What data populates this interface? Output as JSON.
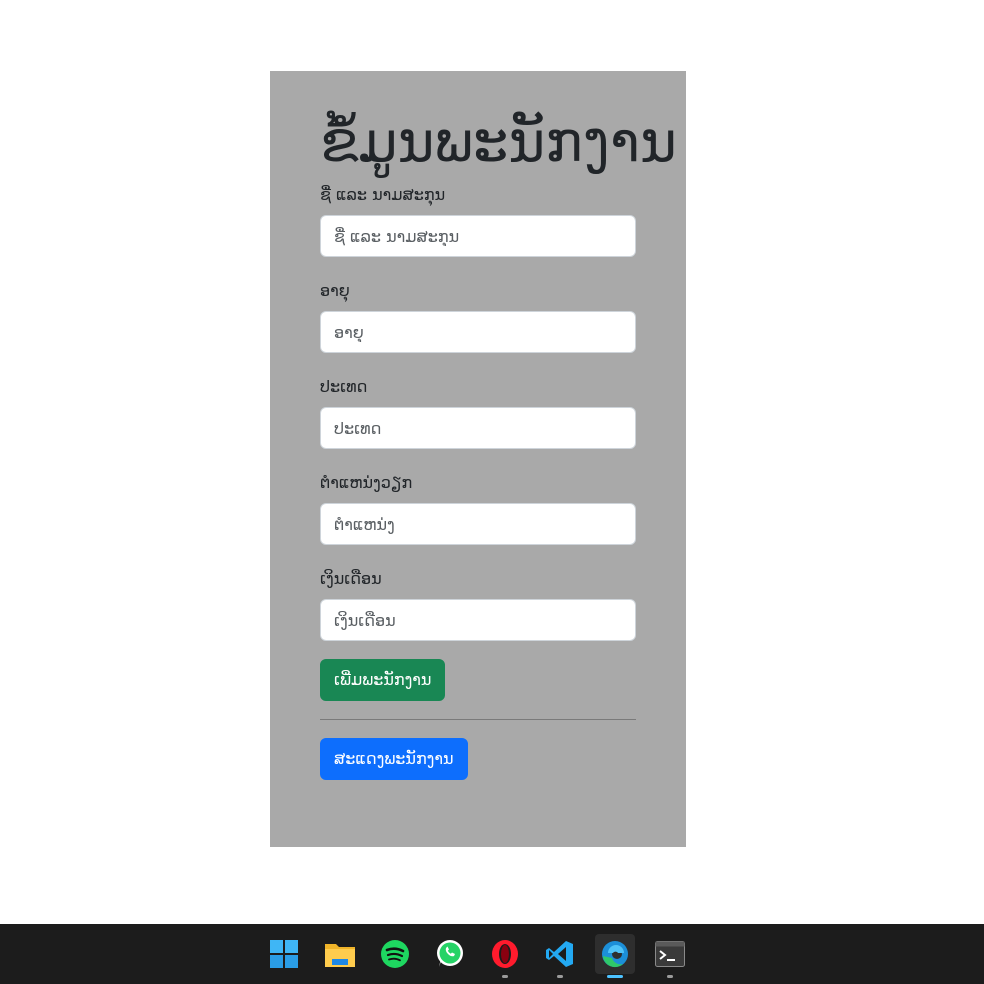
{
  "form": {
    "title": "ຂໍ້ມູນພະນັກງານ",
    "fields": [
      {
        "label": "ຊື່ ແລະ ນາມສະກຸນ",
        "placeholder": "ຊື່ ແລະ ນາມສະກຸນ",
        "value": ""
      },
      {
        "label": "ອາຍຸ",
        "placeholder": "ອາຍຸ",
        "value": ""
      },
      {
        "label": "ປະເທດ",
        "placeholder": "ປະເທດ",
        "value": ""
      },
      {
        "label": "ຕຳແຫນ່ງວຽກ",
        "placeholder": "ຕຳແຫນ່ງ",
        "value": ""
      },
      {
        "label": "ເງິນເດືອນ",
        "placeholder": "ເງິນເດືອນ",
        "value": ""
      }
    ],
    "add_button": "ເພີ່ມພະນັກງານ",
    "show_button": "ສະແດງພະນັກງານ"
  },
  "colors": {
    "card_bg": "#a9a9a9",
    "success": "#198754",
    "primary": "#0d6efd",
    "taskbar_bg": "#1c1c1c"
  },
  "taskbar": {
    "apps": [
      {
        "name": "start-menu-icon",
        "running": false,
        "active": false
      },
      {
        "name": "file-explorer-icon",
        "running": false,
        "active": false
      },
      {
        "name": "spotify-icon",
        "running": false,
        "active": false
      },
      {
        "name": "whatsapp-icon",
        "running": false,
        "active": false
      },
      {
        "name": "opera-icon",
        "running": true,
        "active": false
      },
      {
        "name": "vscode-icon",
        "running": true,
        "active": false
      },
      {
        "name": "edge-icon",
        "running": true,
        "active": true
      },
      {
        "name": "terminal-icon",
        "running": true,
        "active": false
      }
    ]
  }
}
